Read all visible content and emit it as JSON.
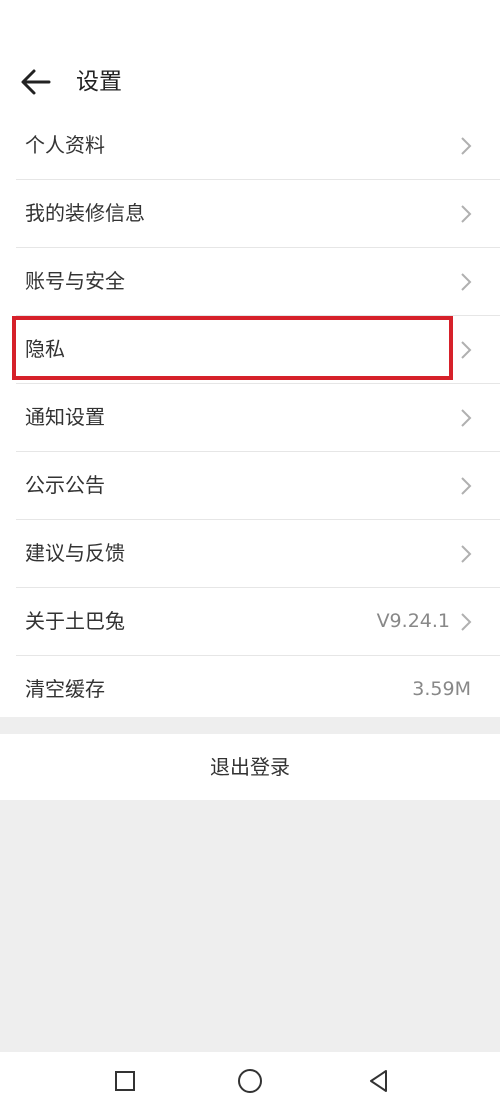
{
  "header": {
    "title": "设置"
  },
  "settings": {
    "items": [
      {
        "label": "个人资料",
        "value": ""
      },
      {
        "label": "我的装修信息",
        "value": ""
      },
      {
        "label": "账号与安全",
        "value": ""
      },
      {
        "label": "隐私",
        "value": ""
      },
      {
        "label": "通知设置",
        "value": ""
      },
      {
        "label": "公示公告",
        "value": ""
      },
      {
        "label": "建议与反馈",
        "value": ""
      },
      {
        "label": "关于土巴兔",
        "value": "V9.24.1"
      },
      {
        "label": "清空缓存",
        "value": "3.59M"
      }
    ]
  },
  "logout": {
    "label": "退出登录"
  },
  "highlight_color": "#d6212a",
  "icons": {
    "back": "arrow-left-icon",
    "chevron": "chevron-right-icon",
    "nav_recents": "square-icon",
    "nav_home": "circle-icon",
    "nav_back": "triangle-back-icon"
  }
}
